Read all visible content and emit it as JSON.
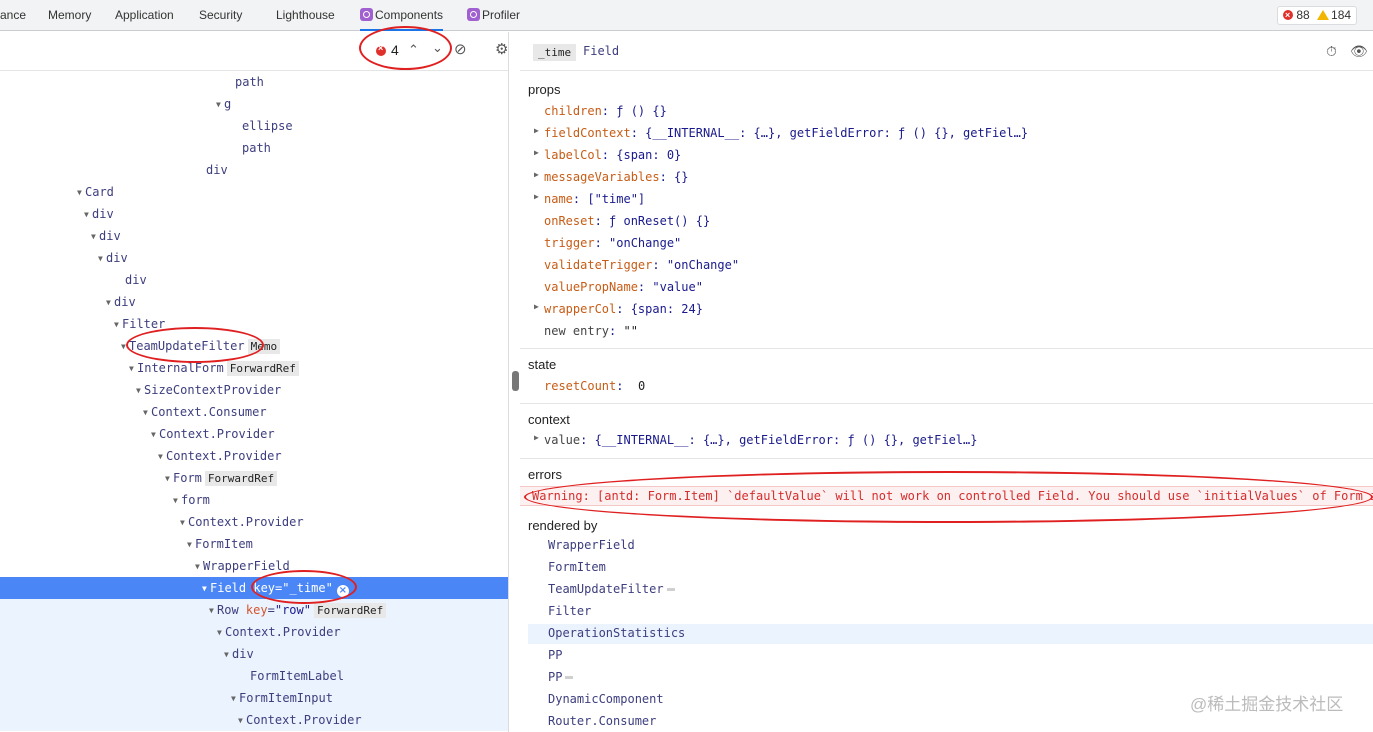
{
  "tabs": [
    {
      "label": "ance"
    },
    {
      "label": "Memory"
    },
    {
      "label": "Application"
    },
    {
      "label": "Security"
    },
    {
      "label": "Lighthouse"
    },
    {
      "label": "Components"
    },
    {
      "label": "Profiler"
    }
  ],
  "issues": {
    "errors": "88",
    "warnings": "184"
  },
  "toolbar": {
    "error_count": "4",
    "prev": "⌃",
    "next": "⌄",
    "no_entry": "⊘",
    "settings": "⚙"
  },
  "tree": [
    {
      "label": "path",
      "arrow": "",
      "badge": ""
    },
    {
      "label": "g",
      "arrow": "▼",
      "badge": ""
    },
    {
      "label": "ellipse",
      "arrow": "",
      "badge": ""
    },
    {
      "label": "path",
      "arrow": "",
      "badge": ""
    },
    {
      "label": "div",
      "arrow": "",
      "badge": ""
    },
    {
      "label": "Card",
      "arrow": "▼",
      "badge": ""
    },
    {
      "label": "div",
      "arrow": "▼",
      "badge": ""
    },
    {
      "label": "div",
      "arrow": "▼",
      "badge": ""
    },
    {
      "label": "div",
      "arrow": "▼",
      "badge": ""
    },
    {
      "label": "div",
      "arrow": "",
      "badge": ""
    },
    {
      "label": "div",
      "arrow": "▼",
      "badge": ""
    },
    {
      "label": "Filter",
      "arrow": "▼",
      "badge": ""
    },
    {
      "label": "TeamUpdateFilter",
      "arrow": "▼",
      "badge": "Memo"
    },
    {
      "label": "InternalForm",
      "arrow": "▼",
      "badge": "ForwardRef"
    },
    {
      "label": "SizeContextProvider",
      "arrow": "▼",
      "badge": ""
    },
    {
      "label": "Context.Consumer",
      "arrow": "▼",
      "badge": ""
    },
    {
      "label": "Context.Provider",
      "arrow": "▼",
      "badge": ""
    },
    {
      "label": "Context.Provider",
      "arrow": "▼",
      "badge": ""
    },
    {
      "label": "Form",
      "arrow": "▼",
      "badge": "ForwardRef"
    },
    {
      "label": "form",
      "arrow": "▼",
      "badge": ""
    },
    {
      "label": "Context.Provider",
      "arrow": "▼",
      "badge": ""
    },
    {
      "label": "FormItem",
      "arrow": "▼",
      "badge": ""
    },
    {
      "label": "WrapperField",
      "arrow": "▼",
      "badge": ""
    },
    {
      "label": "Field",
      "arrow": "▼",
      "badge": "",
      "key_attr": "key",
      "key_val": "\"_time\""
    },
    {
      "label": "Row",
      "arrow": "▼",
      "badge": "ForwardRef",
      "key_attr": "key",
      "key_val": "\"row\""
    },
    {
      "label": "Context.Provider",
      "arrow": "▼",
      "badge": ""
    },
    {
      "label": "div",
      "arrow": "▼",
      "badge": ""
    },
    {
      "label": "FormItemLabel",
      "arrow": "",
      "badge": ""
    },
    {
      "label": "FormItemInput",
      "arrow": "▼",
      "badge": ""
    },
    {
      "label": "Context.Provider",
      "arrow": "▼",
      "badge": ""
    }
  ],
  "inspector": {
    "key_badge": "_time",
    "name": "Field",
    "props_title": "props",
    "props": [
      {
        "key": "children",
        "value": "ƒ () {}",
        "expandable": false
      },
      {
        "key": "fieldContext",
        "value": "{__INTERNAL__: {…}, getFieldError: ƒ () {}, getFiel…}",
        "expandable": true
      },
      {
        "key": "labelCol",
        "value": "{span: 0}",
        "expandable": true
      },
      {
        "key": "messageVariables",
        "value": "{}",
        "expandable": true
      },
      {
        "key": "name",
        "value": "[\"time\"]",
        "expandable": true
      },
      {
        "key": "onReset",
        "value": "ƒ onReset() {}",
        "expandable": false
      },
      {
        "key": "trigger",
        "value": "\"onChange\"",
        "expandable": false
      },
      {
        "key": "validateTrigger",
        "value": "\"onChange\"",
        "expandable": false
      },
      {
        "key": "valuePropName",
        "value": "\"value\"",
        "expandable": false
      },
      {
        "key": "wrapperCol",
        "value": "{span: 24}",
        "expandable": true
      },
      {
        "key": "new entry",
        "value": "\"\"",
        "expandable": false,
        "dim": true
      }
    ],
    "state_title": "state",
    "state": [
      {
        "key": "resetCount",
        "value": "0"
      }
    ],
    "context_title": "context",
    "context": [
      {
        "key": "value",
        "value": "{__INTERNAL__: {…}, getFieldError: ƒ () {}, getFiel…}"
      }
    ],
    "errors_title": "errors",
    "error_message": "Warning: [antd: Form.Item] `defaultValue` will not work on controlled Field. You should use `initialValues` of Form i",
    "rendered_by_title": "rendered by",
    "rendered_by": [
      "WrapperField",
      "FormItem",
      "TeamUpdateFilter",
      "Filter",
      "OperationStatistics",
      "PP",
      "PP",
      "DynamicComponent",
      "Router.Consumer"
    ]
  },
  "watermark": "@稀土掘金技术社区"
}
